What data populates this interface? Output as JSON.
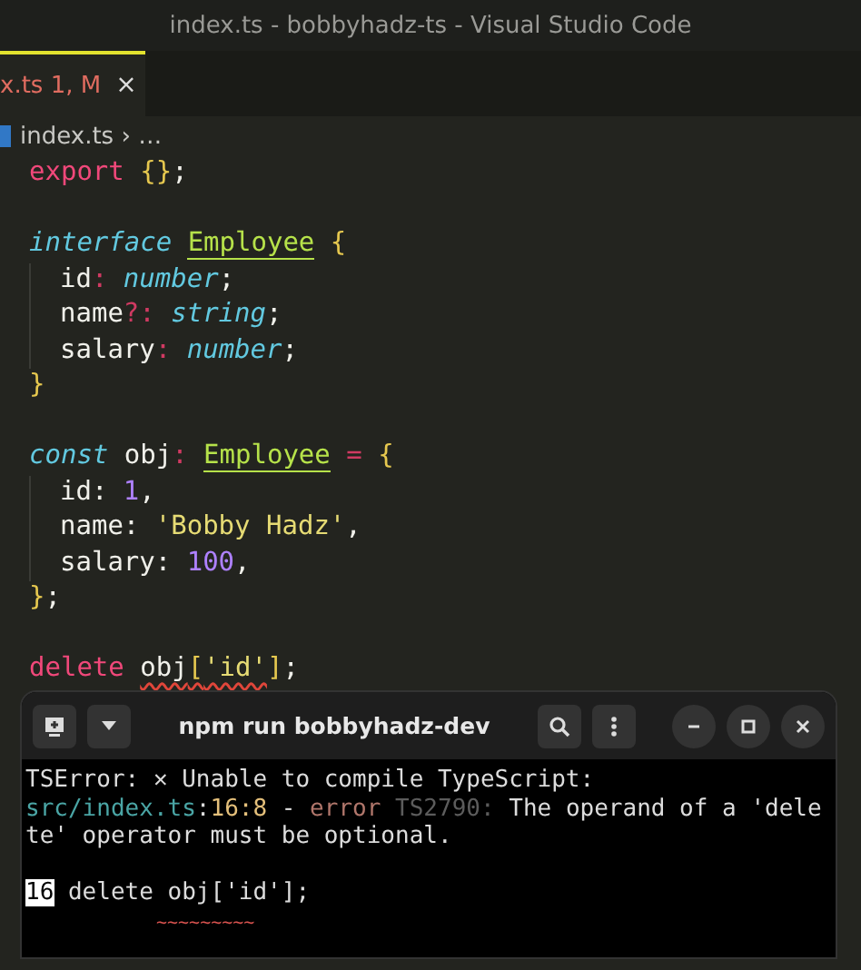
{
  "window": {
    "title": "index.ts - bobbyhadz-ts - Visual Studio Code"
  },
  "tabs": [
    {
      "label": "x.ts",
      "badge": "1, M",
      "close": "×",
      "selected": true
    }
  ],
  "breadcrumb": {
    "file": "index.ts",
    "separator": "›",
    "rest": "…"
  },
  "code": {
    "blocks": [
      [
        {
          "tokens": [
            {
              "kind": "keyword",
              "text": "export"
            },
            {
              "kind": "brace",
              "text": " {}"
            },
            {
              "kind": "plain",
              "text": ";"
            }
          ]
        }
      ],
      [
        {
          "tokens": [
            {
              "kind": "storage",
              "text": "interface "
            },
            {
              "kind": "type",
              "text": "Employee"
            },
            {
              "kind": "brace",
              "text": " {"
            }
          ],
          "children": [
            {
              "tokens": [
                {
                  "kind": "plain",
                  "text": "id"
                },
                {
                  "kind": "operator",
                  "text": ":"
                },
                {
                  "kind": "storage",
                  "text": " number"
                },
                {
                  "kind": "plain",
                  "text": ";"
                }
              ]
            },
            {
              "tokens": [
                {
                  "kind": "plain",
                  "text": "name"
                },
                {
                  "kind": "operator",
                  "text": "?:"
                },
                {
                  "kind": "storage",
                  "text": " string"
                },
                {
                  "kind": "plain",
                  "text": ";"
                }
              ]
            },
            {
              "tokens": [
                {
                  "kind": "plain",
                  "text": "salary"
                },
                {
                  "kind": "operator",
                  "text": ":"
                },
                {
                  "kind": "storage",
                  "text": " number"
                },
                {
                  "kind": "plain",
                  "text": ";"
                }
              ]
            }
          ]
        },
        {
          "tokens": [
            {
              "kind": "brace",
              "text": "}"
            }
          ]
        }
      ],
      [
        {
          "tokens": [
            {
              "kind": "storage",
              "text": "const"
            },
            {
              "kind": "plain",
              "text": " obj"
            },
            {
              "kind": "operator",
              "text": ": "
            },
            {
              "kind": "type",
              "text": "Employee"
            },
            {
              "kind": "operator",
              "text": " ="
            },
            {
              "kind": "brace",
              "text": " {"
            }
          ],
          "children": [
            {
              "tokens": [
                {
                  "kind": "plain",
                  "text": "id: "
                },
                {
                  "kind": "number",
                  "text": "1"
                },
                {
                  "kind": "plain",
                  "text": ","
                }
              ]
            },
            {
              "tokens": [
                {
                  "kind": "plain",
                  "text": "name: "
                },
                {
                  "kind": "string",
                  "text": "'Bobby Hadz'"
                },
                {
                  "kind": "plain",
                  "text": ","
                }
              ]
            },
            {
              "tokens": [
                {
                  "kind": "plain",
                  "text": "salary: "
                },
                {
                  "kind": "number",
                  "text": "100"
                },
                {
                  "kind": "plain",
                  "text": ","
                }
              ]
            }
          ]
        },
        {
          "tokens": [
            {
              "kind": "brace",
              "text": "}"
            },
            {
              "kind": "plain",
              "text": ";"
            }
          ]
        }
      ],
      [
        {
          "tokens": [
            {
              "kind": "keyword",
              "text": "delete "
            },
            {
              "kind": "plain",
              "text": "obj",
              "error": true
            },
            {
              "kind": "brace",
              "text": "[",
              "error": true
            },
            {
              "kind": "string",
              "text": "'id'",
              "error": true
            },
            {
              "kind": "brace",
              "text": "]"
            },
            {
              "kind": "plain",
              "text": ";"
            }
          ]
        }
      ]
    ]
  },
  "terminal": {
    "title": "npm run bobbyhadz-dev",
    "blocks": [
      [
        {
          "tokens": [
            {
              "kind": "plain",
              "text": "TSError: ✕ Unable to compile TypeScript:"
            }
          ]
        },
        {
          "tokens": [
            {
              "kind": "path",
              "text": "src/index.ts"
            },
            {
              "kind": "plain",
              "text": ":"
            },
            {
              "kind": "position",
              "text": "16:8"
            },
            {
              "kind": "plain",
              "text": " -"
            },
            {
              "kind": "error",
              "text": " error"
            },
            {
              "kind": "dim",
              "text": " TS2790:"
            },
            {
              "kind": "plain",
              "text": " The operand of a 'dele"
            }
          ]
        },
        {
          "tokens": [
            {
              "kind": "plain",
              "text": "te' operator must be optional."
            }
          ]
        }
      ],
      [
        {
          "tokens": [
            {
              "kind": "highlight",
              "text": "16"
            },
            {
              "kind": "plain",
              "text": " delete obj['id'];"
            }
          ]
        },
        {
          "tokens": [
            {
              "kind": "squiggle",
              "text": "~~~~~~~~~"
            }
          ]
        }
      ]
    ]
  }
}
